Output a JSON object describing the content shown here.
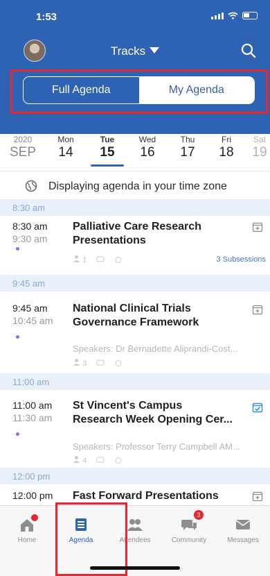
{
  "status_bar": {
    "time": "1:53"
  },
  "header": {
    "title": "Tracks"
  },
  "segments": {
    "full_label": "Full Agenda",
    "my_label": "My Agenda",
    "active": "full"
  },
  "date_strip": {
    "year": "2020",
    "month": "SEP",
    "days": [
      {
        "dow": "Mon",
        "num": "14"
      },
      {
        "dow": "Tue",
        "num": "15"
      },
      {
        "dow": "Wed",
        "num": "16"
      },
      {
        "dow": "Thu",
        "num": "17"
      },
      {
        "dow": "Fri",
        "num": "18"
      },
      {
        "dow": "Sat",
        "num": "19"
      }
    ],
    "selected_index": 1
  },
  "timezone_notice": "Displaying agenda in your time zone",
  "agenda": [
    {
      "header": "8:30 am",
      "start": "8:30 am",
      "end": "9:30 am",
      "title_line1": "Palliative Care Research",
      "title_line2": "Presentations",
      "speakers": "",
      "attendee_count": "1",
      "subsessions": "3 Subsessions",
      "added": false
    },
    {
      "header": "9:45 am",
      "start": "9:45 am",
      "end": "10:45 am",
      "title_line1": "National Clinical Trials",
      "title_line2": "Governance Framework",
      "speakers": "Speakers: Dr Bernadette Aliprandi-Cost...",
      "attendee_count": "3",
      "subsessions": "",
      "added": false
    },
    {
      "header": "11:00 am",
      "start": "11:00 am",
      "end": "11:30 am",
      "title_line1": "St Vincent's Campus",
      "title_line2": "Research Week Opening Cer...",
      "speakers": "Speakers: Professor Terry Campbell AM...",
      "attendee_count": "4",
      "subsessions": "",
      "added": true
    },
    {
      "header": "12:00 pm",
      "start": "12:00 pm",
      "end": "",
      "title_line1": "Fast Forward Presentations",
      "title_line2": "",
      "speakers": "",
      "attendee_count": "",
      "subsessions": "",
      "added": false
    }
  ],
  "tabs": [
    {
      "label": "Home",
      "icon": "home-icon"
    },
    {
      "label": "Agenda",
      "icon": "agenda-icon"
    },
    {
      "label": "Attendees",
      "icon": "attendees-icon"
    },
    {
      "label": "Community",
      "icon": "community-icon",
      "badge": "3"
    },
    {
      "label": "Messages",
      "icon": "messages-icon"
    }
  ],
  "active_tab": "Agenda",
  "colors": {
    "brand": "#2e62b3",
    "highlight": "#e8262f",
    "section_bg": "#e9f0fa"
  }
}
